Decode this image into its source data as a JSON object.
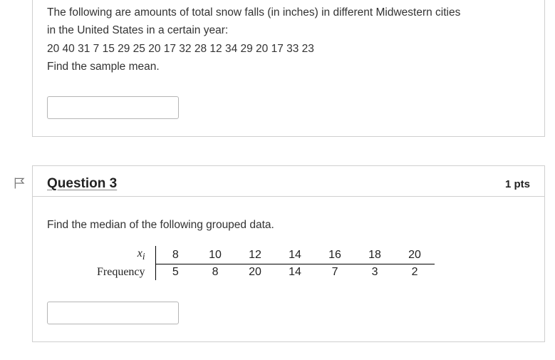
{
  "q2": {
    "text_l1": "The following are amounts of total snow falls (in inches) in different Midwestern cities",
    "text_l2": "in the United States in a certain year:",
    "data_line": "20 40 31 7 15 29 25 20 17   32 28 12 34 29 20 17 33   23",
    "prompt": "Find the sample mean."
  },
  "q3": {
    "title": "Question 3",
    "pts": "1 pts",
    "prompt": "Find the median of the following grouped data.",
    "row_label_x": "x",
    "row_label_x_sub": "i",
    "row_label_f": "Frequency",
    "x": [
      "8",
      "10",
      "12",
      "14",
      "16",
      "18",
      "20"
    ],
    "f": [
      "5",
      "8",
      "20",
      "14",
      "7",
      "3",
      "2"
    ]
  },
  "chart_data": {
    "type": "table",
    "title": "Grouped frequency data",
    "categories": [
      8,
      10,
      12,
      14,
      16,
      18,
      20
    ],
    "values": [
      5,
      8,
      20,
      14,
      7,
      3,
      2
    ],
    "xlabel": "x_i",
    "ylabel": "Frequency"
  }
}
